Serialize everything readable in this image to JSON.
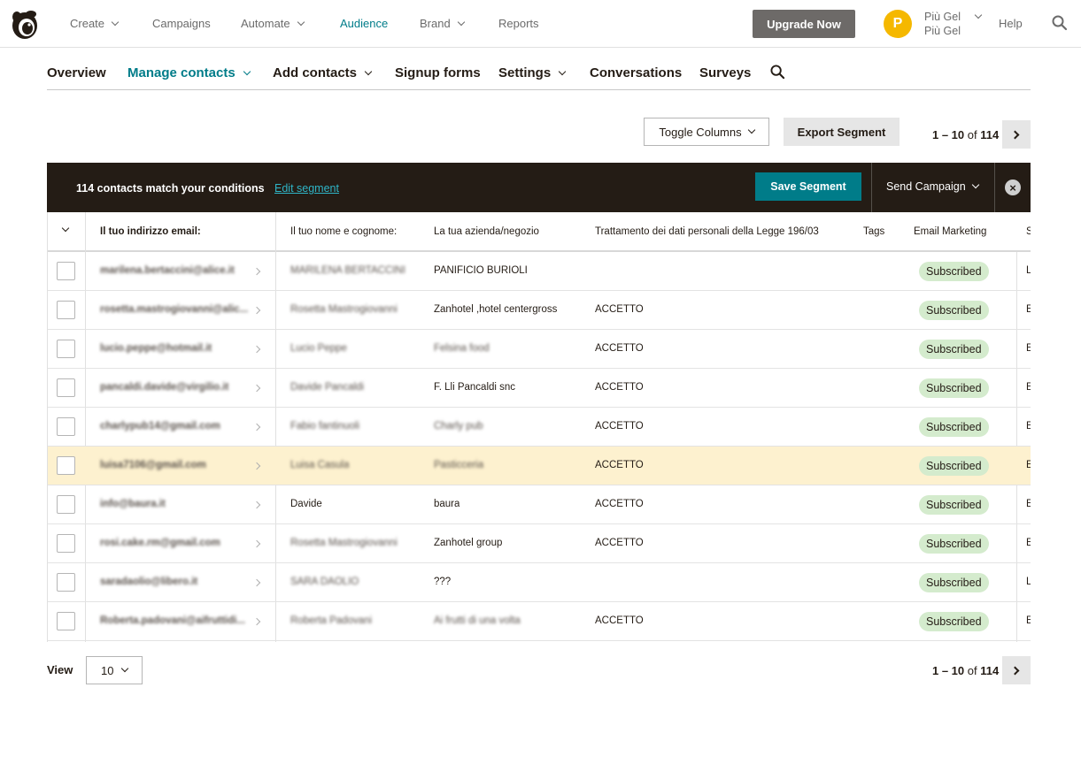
{
  "topnav": {
    "items": [
      {
        "label": "Create",
        "has_menu": true
      },
      {
        "label": "Campaigns",
        "has_menu": false
      },
      {
        "label": "Automate",
        "has_menu": true
      },
      {
        "label": "Audience",
        "has_menu": false,
        "active": true
      },
      {
        "label": "Brand",
        "has_menu": true
      },
      {
        "label": "Reports",
        "has_menu": false
      }
    ],
    "upgrade_label": "Upgrade Now",
    "avatar_initial": "P",
    "account_name": "Più Gel",
    "account_org": "Più Gel",
    "help_label": "Help",
    "search_icon": "search-icon"
  },
  "subnav": {
    "items": [
      {
        "label": "Overview",
        "has_menu": false
      },
      {
        "label": "Manage contacts",
        "has_menu": true,
        "active": true
      },
      {
        "label": "Add contacts",
        "has_menu": true
      },
      {
        "label": "Signup forms",
        "has_menu": false
      },
      {
        "label": "Settings",
        "has_menu": true
      },
      {
        "label": "Conversations",
        "has_menu": false
      },
      {
        "label": "Surveys",
        "has_menu": false
      }
    ],
    "search_icon": "search-icon"
  },
  "toolbar": {
    "toggle_columns_label": "Toggle Columns",
    "export_label": "Export Segment"
  },
  "pagination": {
    "range": "1 – 10",
    "of_label": "of",
    "total": "114"
  },
  "segment_bar": {
    "match_text": "114 contacts match your conditions",
    "edit_label": "Edit segment",
    "save_label": "Save Segment",
    "send_label": "Send Campaign",
    "close_icon": "close-icon"
  },
  "table": {
    "columns": [
      "Il tuo indirizzo email:",
      "Il tuo nome e cognome:",
      "La tua azienda/negozio",
      "Trattamento dei dati personali della Legge 196/03",
      "Tags",
      "Email Marketing",
      "S"
    ],
    "rows": [
      {
        "email": "marilena.bertaccini@alice.it",
        "name": "MARILENA BERTACCINI",
        "company": "PANIFICIO BURIOLI",
        "privacy": "",
        "status": "Subscribed",
        "last": "L",
        "highlight": false
      },
      {
        "email": "rosetta.mastrogiovanni@alic...",
        "name": "Rosetta Mastrogiovanni",
        "company": "Zanhotel ,hotel centergross",
        "privacy": "ACCETTO",
        "status": "Subscribed",
        "last": "E",
        "highlight": false
      },
      {
        "email": "lucio.peppe@hotmail.it",
        "name": "Lucio Peppe",
        "company": "Felsina food",
        "privacy": "ACCETTO",
        "status": "Subscribed",
        "last": "E",
        "highlight": false
      },
      {
        "email": "pancaldi.davide@virgilio.it",
        "name": "Davide Pancaldi",
        "company": "F. Lli Pancaldi snc",
        "privacy": "ACCETTO",
        "status": "Subscribed",
        "last": "E",
        "highlight": false
      },
      {
        "email": "charlypub14@gmail.com",
        "name": "Fabio fantinuoli",
        "company": "Charly pub",
        "privacy": "ACCETTO",
        "status": "Subscribed",
        "last": "E",
        "highlight": false
      },
      {
        "email": "luisa7106@gmail.com",
        "name": "Luisa Casula",
        "company": "Pasticceria",
        "privacy": "ACCETTO",
        "status": "Subscribed",
        "last": "E",
        "highlight": true
      },
      {
        "email": "info@baura.it",
        "name": "Davide",
        "company": "baura",
        "privacy": "ACCETTO",
        "status": "Subscribed",
        "last": "E",
        "highlight": false
      },
      {
        "email": "rosi.cake.rm@gmail.com",
        "name": "Rosetta Mastrogiovanni",
        "company": "Zanhotel group",
        "privacy": "ACCETTO",
        "status": "Subscribed",
        "last": "E",
        "highlight": false
      },
      {
        "email": "saradaolio@libero.it",
        "name": "SARA DAOLIO",
        "company": "???",
        "privacy": "",
        "status": "Subscribed",
        "last": "L",
        "highlight": false
      },
      {
        "email": "Roberta.padovani@aifruttidi...",
        "name": "Roberta Padovani",
        "company": "Ai frutti di una volta",
        "privacy": "ACCETTO",
        "status": "Subscribed",
        "last": "E",
        "highlight": false
      }
    ]
  },
  "footer": {
    "view_label": "View",
    "per_page": "10"
  },
  "colors": {
    "accent": "#007c89",
    "dark_bar": "#241c15",
    "badge_bg": "#d4ebcd",
    "highlight_row": "#fdf1cf",
    "avatar": "#f5b800"
  }
}
